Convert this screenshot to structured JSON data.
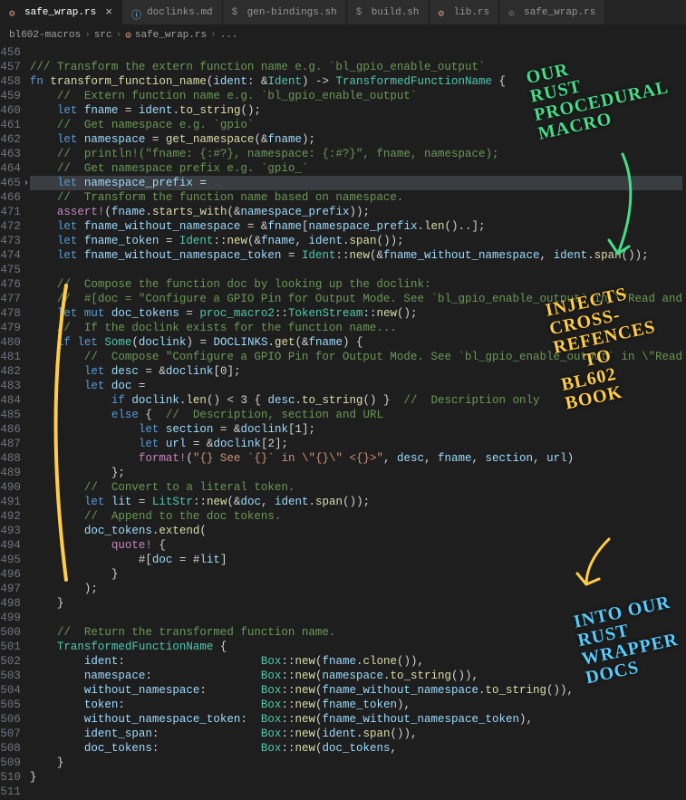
{
  "tabs": [
    {
      "icon": "rust-icon",
      "label": "safe_wrap.rs",
      "active": true,
      "closeable": true
    },
    {
      "icon": "info-icon",
      "label": "doclinks.md",
      "active": false
    },
    {
      "icon": "sh-icon",
      "label": "gen-bindings.sh",
      "active": false
    },
    {
      "icon": "sh-icon",
      "label": "build.sh",
      "active": false
    },
    {
      "icon": "rust-icon",
      "label": "lib.rs",
      "active": false
    },
    {
      "icon": "rust-icon-dim",
      "label": "safe_wrap.rs",
      "active": false
    }
  ],
  "breadcrumbs": {
    "items": [
      "bl602-macros",
      "src",
      "safe_wrap.rs",
      "..."
    ],
    "file_icon": "rust-icon"
  },
  "annotations": {
    "a1_l1": "OUR",
    "a1_l2": "RUST",
    "a1_l3": "PROCEDURAL",
    "a1_l4": "MACRO",
    "a2_l1": "INJECTS",
    "a2_l2": "CROSS-",
    "a2_l3": "REFENCES",
    "a2_l4": "TO",
    "a2_l5": "BL602",
    "a2_l6": "BOOK",
    "a3_l1": "INTO OUR",
    "a3_l2": "RUST",
    "a3_l3": "WRAPPER",
    "a3_l4": "DOCS"
  },
  "code": {
    "line_start": 456,
    "skip_from": 466,
    "skip_to": 470,
    "lines": [
      [
        [
          "",
          ""
        ]
      ],
      [
        [
          "c-com",
          "/// Transform the extern function name e.g. `bl_gpio_enable_output`"
        ]
      ],
      [
        [
          "c-kw",
          "fn "
        ],
        [
          "c-fn",
          "transform_function_name"
        ],
        [
          "c-none",
          "("
        ],
        [
          "c-var",
          "ident"
        ],
        [
          "c-none",
          ": &"
        ],
        [
          "c-type",
          "Ident"
        ],
        [
          "c-none",
          ") -> "
        ],
        [
          "c-type",
          "TransformedFunctionName"
        ],
        [
          "c-none",
          " {"
        ]
      ],
      [
        [
          "c-none",
          "    "
        ],
        [
          "c-com",
          "//  Extern function name e.g. `bl_gpio_enable_output`"
        ]
      ],
      [
        [
          "c-none",
          "    "
        ],
        [
          "c-kw",
          "let "
        ],
        [
          "c-var",
          "fname"
        ],
        [
          "c-none",
          " = "
        ],
        [
          "c-var",
          "ident"
        ],
        [
          "c-none",
          "."
        ],
        [
          "c-fn",
          "to_string"
        ],
        [
          "c-none",
          "();"
        ]
      ],
      [
        [
          "c-none",
          "    "
        ],
        [
          "c-com",
          "//  Get namespace e.g. `gpio`"
        ]
      ],
      [
        [
          "c-none",
          "    "
        ],
        [
          "c-kw",
          "let "
        ],
        [
          "c-var",
          "namespace"
        ],
        [
          "c-none",
          " = "
        ],
        [
          "c-fn",
          "get_namespace"
        ],
        [
          "c-none",
          "(&"
        ],
        [
          "c-var",
          "fname"
        ],
        [
          "c-none",
          ");"
        ]
      ],
      [
        [
          "c-none",
          "    "
        ],
        [
          "c-com",
          "//  println!(\"fname: {:#?}, namespace: {:#?}\", fname, namespace);"
        ]
      ],
      [
        [
          "c-none",
          "    "
        ],
        [
          "c-com",
          "//  Get namespace prefix e.g. `gpio_`"
        ]
      ],
      [
        [
          "c-none",
          "    "
        ],
        [
          "c-kw",
          "let "
        ],
        [
          "c-var",
          "namespace_prefix"
        ],
        [
          "c-none",
          " = "
        ],
        [
          "c-dim",
          "…"
        ]
      ],
      [
        [
          "c-none",
          "    "
        ],
        [
          "c-com",
          "//  Transform the function name based on namespace."
        ]
      ],
      [
        [
          "c-none",
          "    "
        ],
        [
          "c-macro",
          "assert!"
        ],
        [
          "c-none",
          "("
        ],
        [
          "c-var",
          "fname"
        ],
        [
          "c-none",
          "."
        ],
        [
          "c-fn",
          "starts_with"
        ],
        [
          "c-none",
          "(&"
        ],
        [
          "c-var",
          "namespace_prefix"
        ],
        [
          "c-none",
          "));"
        ]
      ],
      [
        [
          "c-none",
          "    "
        ],
        [
          "c-kw",
          "let "
        ],
        [
          "c-var",
          "fname_without_namespace"
        ],
        [
          "c-none",
          " = &"
        ],
        [
          "c-var",
          "fname"
        ],
        [
          "c-none",
          "["
        ],
        [
          "c-var",
          "namespace_prefix"
        ],
        [
          "c-none",
          "."
        ],
        [
          "c-fn",
          "len"
        ],
        [
          "c-none",
          "()..];"
        ]
      ],
      [
        [
          "c-none",
          "    "
        ],
        [
          "c-kw",
          "let "
        ],
        [
          "c-var",
          "fname_token"
        ],
        [
          "c-none",
          " = "
        ],
        [
          "c-type",
          "Ident"
        ],
        [
          "c-none",
          "::"
        ],
        [
          "c-fn",
          "new"
        ],
        [
          "c-none",
          "(&"
        ],
        [
          "c-var",
          "fname"
        ],
        [
          "c-none",
          ", "
        ],
        [
          "c-var",
          "ident"
        ],
        [
          "c-none",
          "."
        ],
        [
          "c-fn",
          "span"
        ],
        [
          "c-none",
          "());"
        ]
      ],
      [
        [
          "c-none",
          "    "
        ],
        [
          "c-kw",
          "let "
        ],
        [
          "c-var",
          "fname_without_namespace_token"
        ],
        [
          "c-none",
          " = "
        ],
        [
          "c-type",
          "Ident"
        ],
        [
          "c-none",
          "::"
        ],
        [
          "c-fn",
          "new"
        ],
        [
          "c-none",
          "(&"
        ],
        [
          "c-var",
          "fname_without_namespace"
        ],
        [
          "c-none",
          ", "
        ],
        [
          "c-var",
          "ident"
        ],
        [
          "c-none",
          "."
        ],
        [
          "c-fn",
          "span"
        ],
        [
          "c-none",
          "());"
        ]
      ],
      [
        [
          "",
          ""
        ]
      ],
      [
        [
          "c-none",
          "    "
        ],
        [
          "c-com",
          "//  Compose the function doc by looking up the doclink:"
        ]
      ],
      [
        [
          "c-none",
          "    "
        ],
        [
          "c-com",
          "//  #[doc = \"Configure a GPIO Pin for Output Mode. See `bl_gpio_enable_output` in \\\"Read and"
        ]
      ],
      [
        [
          "c-none",
          "    "
        ],
        [
          "c-kw",
          "let mut "
        ],
        [
          "c-var",
          "doc_tokens"
        ],
        [
          "c-none",
          " = "
        ],
        [
          "c-type",
          "proc_macro2"
        ],
        [
          "c-none",
          "::"
        ],
        [
          "c-type",
          "TokenStream"
        ],
        [
          "c-none",
          "::"
        ],
        [
          "c-fn",
          "new"
        ],
        [
          "c-none",
          "();"
        ]
      ],
      [
        [
          "c-none",
          "    "
        ],
        [
          "c-com",
          "//  If the doclink exists for the function name..."
        ]
      ],
      [
        [
          "c-none",
          "    "
        ],
        [
          "c-kw",
          "if let "
        ],
        [
          "c-type",
          "Some"
        ],
        [
          "c-none",
          "("
        ],
        [
          "c-var",
          "doclink"
        ],
        [
          "c-none",
          ") = "
        ],
        [
          "c-var",
          "DOCLINKS"
        ],
        [
          "c-none",
          "."
        ],
        [
          "c-fn",
          "get"
        ],
        [
          "c-none",
          "(&"
        ],
        [
          "c-var",
          "fname"
        ],
        [
          "c-none",
          ") {"
        ]
      ],
      [
        [
          "c-none",
          "        "
        ],
        [
          "c-com",
          "//  Compose \"Configure a GPIO Pin for Output Mode. See `bl_gpio_enable_output` in \\\"Read"
        ]
      ],
      [
        [
          "c-none",
          "        "
        ],
        [
          "c-kw",
          "let "
        ],
        [
          "c-var",
          "desc"
        ],
        [
          "c-none",
          " = &"
        ],
        [
          "c-var",
          "doclink"
        ],
        [
          "c-none",
          "[0];"
        ]
      ],
      [
        [
          "c-none",
          "        "
        ],
        [
          "c-kw",
          "let "
        ],
        [
          "c-var",
          "doc"
        ],
        [
          "c-none",
          " ="
        ]
      ],
      [
        [
          "c-none",
          "            "
        ],
        [
          "c-kw",
          "if "
        ],
        [
          "c-var",
          "doclink"
        ],
        [
          "c-none",
          "."
        ],
        [
          "c-fn",
          "len"
        ],
        [
          "c-none",
          "() < 3 { "
        ],
        [
          "c-var",
          "desc"
        ],
        [
          "c-none",
          "."
        ],
        [
          "c-fn",
          "to_string"
        ],
        [
          "c-none",
          "() }  "
        ],
        [
          "c-com",
          "//  Description only"
        ]
      ],
      [
        [
          "c-none",
          "            "
        ],
        [
          "c-kw",
          "else"
        ],
        [
          "c-none",
          " {  "
        ],
        [
          "c-com",
          "//  Description, section and URL"
        ]
      ],
      [
        [
          "c-none",
          "                "
        ],
        [
          "c-kw",
          "let "
        ],
        [
          "c-var",
          "section"
        ],
        [
          "c-none",
          " = &"
        ],
        [
          "c-var",
          "doclink"
        ],
        [
          "c-none",
          "[1];"
        ]
      ],
      [
        [
          "c-none",
          "                "
        ],
        [
          "c-kw",
          "let "
        ],
        [
          "c-var",
          "url"
        ],
        [
          "c-none",
          " = &"
        ],
        [
          "c-var",
          "doclink"
        ],
        [
          "c-none",
          "[2];"
        ]
      ],
      [
        [
          "c-none",
          "                "
        ],
        [
          "c-macro",
          "format!"
        ],
        [
          "c-none",
          "("
        ],
        [
          "c-str",
          "\"{} See `{}` in \\\"{}\\\" <{}>\""
        ],
        [
          "c-none",
          ", "
        ],
        [
          "c-var",
          "desc"
        ],
        [
          "c-none",
          ", "
        ],
        [
          "c-var",
          "fname"
        ],
        [
          "c-none",
          ", "
        ],
        [
          "c-var",
          "section"
        ],
        [
          "c-none",
          ", "
        ],
        [
          "c-var",
          "url"
        ],
        [
          "c-none",
          ")"
        ]
      ],
      [
        [
          "c-none",
          "            };"
        ]
      ],
      [
        [
          "c-none",
          "        "
        ],
        [
          "c-com",
          "//  Convert to a literal token."
        ]
      ],
      [
        [
          "c-none",
          "        "
        ],
        [
          "c-kw",
          "let "
        ],
        [
          "c-var",
          "lit"
        ],
        [
          "c-none",
          " = "
        ],
        [
          "c-type",
          "LitStr"
        ],
        [
          "c-none",
          "::"
        ],
        [
          "c-fn",
          "new"
        ],
        [
          "c-none",
          "(&"
        ],
        [
          "c-var",
          "doc"
        ],
        [
          "c-none",
          ", "
        ],
        [
          "c-var",
          "ident"
        ],
        [
          "c-none",
          "."
        ],
        [
          "c-fn",
          "span"
        ],
        [
          "c-none",
          "());"
        ]
      ],
      [
        [
          "c-none",
          "        "
        ],
        [
          "c-com",
          "//  Append to the doc tokens."
        ]
      ],
      [
        [
          "c-none",
          "        "
        ],
        [
          "c-var",
          "doc_tokens"
        ],
        [
          "c-none",
          "."
        ],
        [
          "c-fn",
          "extend"
        ],
        [
          "c-none",
          "("
        ]
      ],
      [
        [
          "c-none",
          "            "
        ],
        [
          "c-macro",
          "quote!"
        ],
        [
          "c-none",
          " {"
        ]
      ],
      [
        [
          "c-none",
          "                #["
        ],
        [
          "c-var",
          "doc"
        ],
        [
          "c-none",
          " = #"
        ],
        [
          "c-var",
          "lit"
        ],
        [
          "c-none",
          "]"
        ]
      ],
      [
        [
          "c-none",
          "            }"
        ]
      ],
      [
        [
          "c-none",
          "        );"
        ]
      ],
      [
        [
          "c-none",
          "    }"
        ]
      ],
      [
        [
          "",
          ""
        ]
      ],
      [
        [
          "c-none",
          "    "
        ],
        [
          "c-com",
          "//  Return the transformed function name."
        ]
      ],
      [
        [
          "c-none",
          "    "
        ],
        [
          "c-type",
          "TransformedFunctionName"
        ],
        [
          "c-none",
          " {"
        ]
      ],
      [
        [
          "c-none",
          "        "
        ],
        [
          "c-var",
          "ident"
        ],
        [
          "c-none",
          ":                    "
        ],
        [
          "c-type",
          "Box"
        ],
        [
          "c-none",
          "::"
        ],
        [
          "c-fn",
          "new"
        ],
        [
          "c-none",
          "("
        ],
        [
          "c-var",
          "fname"
        ],
        [
          "c-none",
          "."
        ],
        [
          "c-fn",
          "clone"
        ],
        [
          "c-none",
          "()),"
        ]
      ],
      [
        [
          "c-none",
          "        "
        ],
        [
          "c-var",
          "namespace"
        ],
        [
          "c-none",
          ":                "
        ],
        [
          "c-type",
          "Box"
        ],
        [
          "c-none",
          "::"
        ],
        [
          "c-fn",
          "new"
        ],
        [
          "c-none",
          "("
        ],
        [
          "c-var",
          "namespace"
        ],
        [
          "c-none",
          "."
        ],
        [
          "c-fn",
          "to_string"
        ],
        [
          "c-none",
          "()),"
        ]
      ],
      [
        [
          "c-none",
          "        "
        ],
        [
          "c-var",
          "without_namespace"
        ],
        [
          "c-none",
          ":        "
        ],
        [
          "c-type",
          "Box"
        ],
        [
          "c-none",
          "::"
        ],
        [
          "c-fn",
          "new"
        ],
        [
          "c-none",
          "("
        ],
        [
          "c-var",
          "fname_without_namespace"
        ],
        [
          "c-none",
          "."
        ],
        [
          "c-fn",
          "to_string"
        ],
        [
          "c-none",
          "()),"
        ]
      ],
      [
        [
          "c-none",
          "        "
        ],
        [
          "c-var",
          "token"
        ],
        [
          "c-none",
          ":                    "
        ],
        [
          "c-type",
          "Box"
        ],
        [
          "c-none",
          "::"
        ],
        [
          "c-fn",
          "new"
        ],
        [
          "c-none",
          "("
        ],
        [
          "c-var",
          "fname_token"
        ],
        [
          "c-none",
          "),"
        ]
      ],
      [
        [
          "c-none",
          "        "
        ],
        [
          "c-var",
          "without_namespace_token"
        ],
        [
          "c-none",
          ":  "
        ],
        [
          "c-type",
          "Box"
        ],
        [
          "c-none",
          "::"
        ],
        [
          "c-fn",
          "new"
        ],
        [
          "c-none",
          "("
        ],
        [
          "c-var",
          "fname_without_namespace_token"
        ],
        [
          "c-none",
          "),"
        ]
      ],
      [
        [
          "c-none",
          "        "
        ],
        [
          "c-var",
          "ident_span"
        ],
        [
          "c-none",
          ":               "
        ],
        [
          "c-type",
          "Box"
        ],
        [
          "c-none",
          "::"
        ],
        [
          "c-fn",
          "new"
        ],
        [
          "c-none",
          "("
        ],
        [
          "c-var",
          "ident"
        ],
        [
          "c-none",
          "."
        ],
        [
          "c-fn",
          "span"
        ],
        [
          "c-none",
          "()),"
        ]
      ],
      [
        [
          "c-none",
          "        "
        ],
        [
          "c-var",
          "doc_tokens"
        ],
        [
          "c-none",
          ":               "
        ],
        [
          "c-type",
          "Box"
        ],
        [
          "c-none",
          "::"
        ],
        [
          "c-fn",
          "new"
        ],
        [
          "c-none",
          "("
        ],
        [
          "c-var",
          "doc_tokens"
        ],
        [
          "c-none",
          ","
        ]
      ],
      [
        [
          "c-none",
          "    }"
        ]
      ],
      [
        [
          "c-none",
          "}"
        ]
      ],
      [
        [
          "",
          ""
        ]
      ]
    ]
  }
}
